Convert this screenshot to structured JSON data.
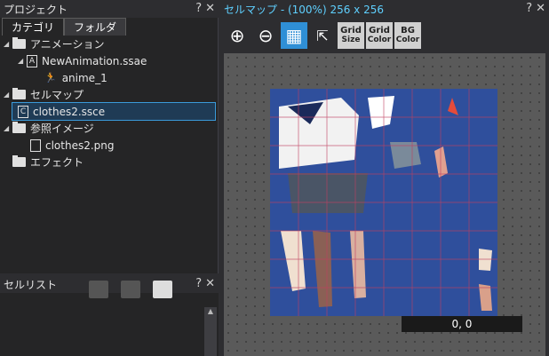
{
  "project": {
    "title": "プロジェクト",
    "tabs": [
      {
        "label": "カテゴリ"
      },
      {
        "label": "フォルダ"
      }
    ],
    "tree": [
      {
        "label": "アニメーション"
      },
      {
        "label": "NewAnimation.ssae"
      },
      {
        "label": "anime_1"
      },
      {
        "label": "セルマップ"
      },
      {
        "label": "clothes2.ssce"
      },
      {
        "label": "参照イメージ"
      },
      {
        "label": "clothes2.png"
      },
      {
        "label": "エフェクト"
      }
    ],
    "help": "?",
    "close": "✕"
  },
  "cellist": {
    "title": "セルリスト",
    "help": "?",
    "close": "✕"
  },
  "cellmap": {
    "title": "セルマップ - (100%)  256 x 256",
    "help": "?",
    "close": "✕",
    "toolbar": [
      {
        "icon": "zoom-in-icon"
      },
      {
        "icon": "zoom-out-icon"
      },
      {
        "icon": "grid-icon"
      },
      {
        "icon": "pivot-icon"
      }
    ],
    "toolbar_text": [
      {
        "line1": "Grid",
        "line2": "Size"
      },
      {
        "line1": "Grid",
        "line2": "Color"
      },
      {
        "line1": "BG",
        "line2": "Color"
      }
    ],
    "coords": "0, 0"
  }
}
